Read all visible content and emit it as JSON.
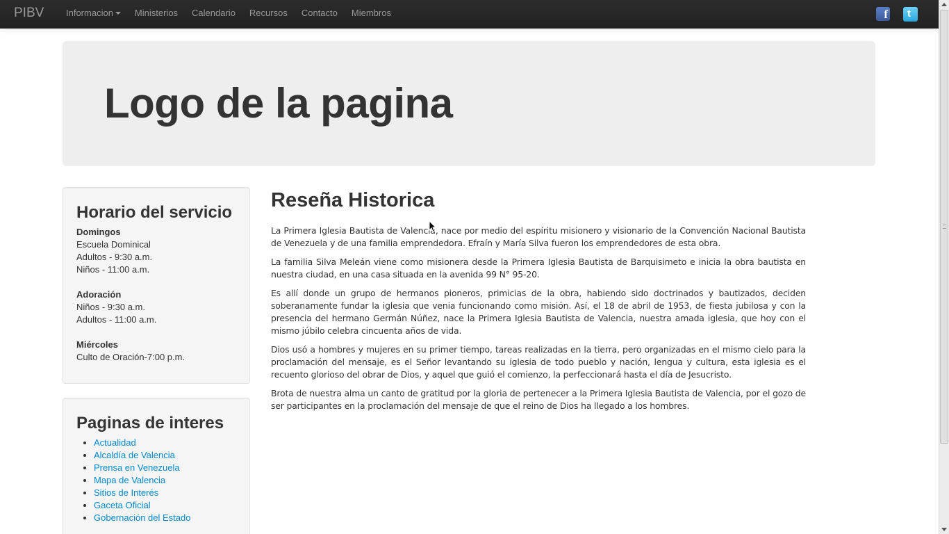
{
  "navbar": {
    "brand": "PIBV",
    "items": [
      {
        "label": "Informacion",
        "dropdown": true
      },
      {
        "label": "Ministerios"
      },
      {
        "label": "Calendario"
      },
      {
        "label": "Recursos"
      },
      {
        "label": "Contacto"
      },
      {
        "label": "Miembros"
      }
    ],
    "social": [
      {
        "icon": "facebook-icon",
        "glyph": "f"
      },
      {
        "icon": "twitter-icon",
        "glyph": "t"
      }
    ]
  },
  "hero": {
    "title": "Logo de la pagina"
  },
  "schedule": {
    "title": "Horario del servicio",
    "groups": [
      {
        "day": "Domingos",
        "lines": [
          "Escuela Dominical",
          "Adultos - 9:30 a.m.",
          "Niños - 11:00 a.m."
        ]
      },
      {
        "day": "Adoración",
        "lines": [
          "Niños - 9:30 a.m.",
          "Adultos - 11:00 a.m."
        ]
      },
      {
        "day": "Miércoles",
        "lines": [
          "Culto de Oración-7:00 p.m."
        ]
      }
    ]
  },
  "links": {
    "title": "Paginas de interes",
    "items": [
      "Actualidad",
      "Alcaldía de Valencia",
      "Prensa en Venezuela",
      "Mapa de Valencia",
      "Sitios de Interés",
      "Gaceta Oficial",
      "Gobernación del Estado"
    ]
  },
  "main": {
    "title": "Reseña Historica",
    "paragraphs": [
      "La Primera Iglesia Bautista de Valencia, nace por medio del espíritu misionero y visionario de la Convención Nacional Bautista de Venezuela y de una familia emprendedora. Efraín y María Silva fueron los emprendedores de esta obra.",
      "La familia Silva Meleán viene como misionera desde la Primera Iglesia Bautista de Barquisimeto e inicia la obra bautista en nuestra ciudad, en una casa situada en la avenida 99 N° 95-20.",
      "Es allí donde un grupo de hermanos pioneros, primicias de la obra, habiendo sido doctrinados y bautizados, deciden soberanamente fundar la iglesia que venia funcionando como misión. Así, el 18 de abril de 1953, de fiesta jubilosa y con la presencia del hermano Germán Núñez, nace la Primera Iglesia Bautista de Valencia, nuestra amada iglesia, que hoy con el mismo júbilo celebra cincuenta años de vida.",
      "Dios usó a hombres y mujeres en su primer tiempo, tareas realizadas en la tierra, pero organizadas en el mismo cielo para la proclamación del mensaje, es el Señor levantando su iglesia de todo pueblo y nación, lengua y cultura, esta iglesia es el recuento glorioso del obrar de Dios, y aquel que guió el comienzo, la perfeccionará hasta el día de Jesucristo.",
      "Brota de nuestra alma un canto de gratitud por la gloria de pertenecer a la Primera Iglesia Bautista de Valencia, por el gozo de ser participantes en la proclamación del mensaje de que el reino de Dios ha llegado a los hombres."
    ]
  },
  "colors": {
    "navbar": "#222222",
    "link": "#0088cc",
    "hero_bg": "#eeeeee",
    "well_bg": "#f5f5f5"
  }
}
